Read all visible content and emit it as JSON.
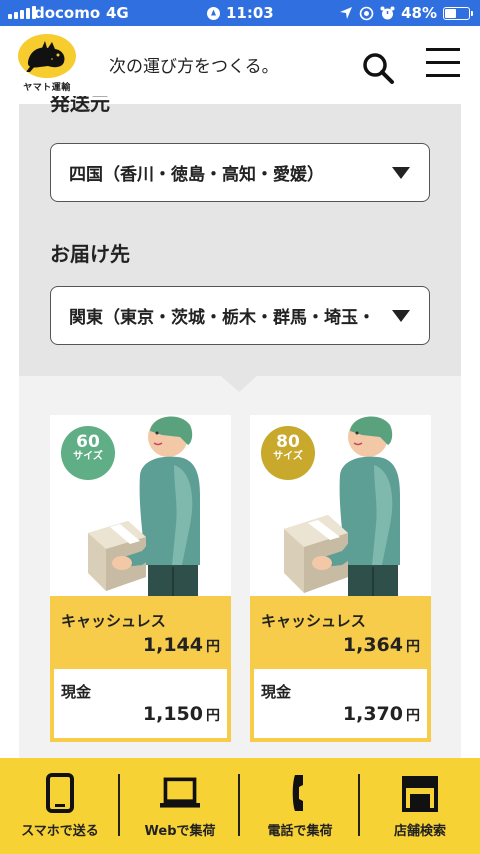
{
  "status_bar": {
    "carrier": "docomo",
    "network": "4G",
    "time": "11:03",
    "battery": "48%",
    "battery_level": 0.48,
    "color": "#2f6fe0"
  },
  "header": {
    "logo_text": "ヤマト運輸",
    "tagline": "次の運び方をつくる。",
    "search_icon": "search-icon",
    "menu_icon": "hamburger-menu-icon"
  },
  "form": {
    "origin_label": "発送元",
    "origin_value": "四国（香川・徳島・高知・愛媛）",
    "destination_label": "お届け先",
    "destination_value": "関東（東京・茨城・栃木・群馬・埼玉・千葉・神奈川・山梨）"
  },
  "cards": [
    {
      "size_num": "60",
      "size_unit": "サイズ",
      "badge_color": "#5fae86",
      "cashless_label": "キャッシュレス",
      "cashless_price": "1,144",
      "cash_label": "現金",
      "cash_price": "1,150",
      "currency": "円"
    },
    {
      "size_num": "80",
      "size_unit": "サイズ",
      "badge_color": "#c8a92c",
      "cashless_label": "キャッシュレス",
      "cashless_price": "1,364",
      "cash_label": "現金",
      "cash_price": "1,370",
      "currency": "円"
    }
  ],
  "bottom_nav": [
    {
      "label": "スマホで送る",
      "icon": "smartphone-icon"
    },
    {
      "label": "Webで集荷",
      "icon": "laptop-icon"
    },
    {
      "label": "電話で集荷",
      "icon": "phone-icon"
    },
    {
      "label": "店舗検索",
      "icon": "store-icon"
    }
  ],
  "colors": {
    "brand_yellow": "#f7cc2f",
    "nav_yellow": "#f7d235",
    "panel_gray": "#e5e5e5"
  }
}
